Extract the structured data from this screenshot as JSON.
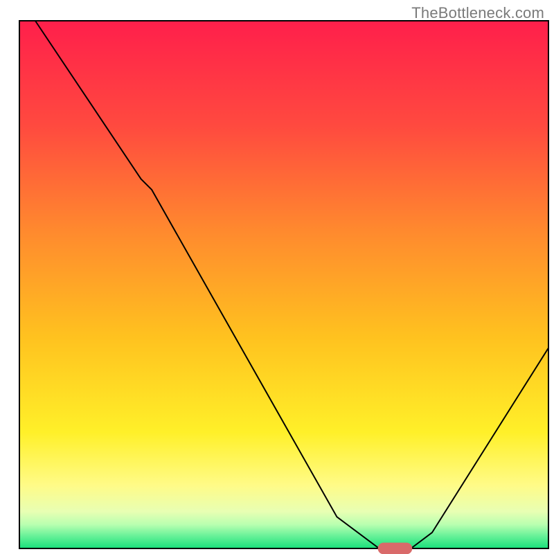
{
  "watermark": "TheBottleneck.com",
  "chart_data": {
    "type": "line",
    "title": "",
    "xlabel": "",
    "ylabel": "",
    "xlim": [
      0,
      100
    ],
    "ylim": [
      0,
      100
    ],
    "grid": false,
    "legend": false,
    "background": {
      "type": "vertical-gradient",
      "stops": [
        {
          "pos": 0.0,
          "color": "#ff1f4b"
        },
        {
          "pos": 0.2,
          "color": "#ff4a3f"
        },
        {
          "pos": 0.4,
          "color": "#ff8a2e"
        },
        {
          "pos": 0.6,
          "color": "#ffc21f"
        },
        {
          "pos": 0.78,
          "color": "#fff029"
        },
        {
          "pos": 0.88,
          "color": "#fffb87"
        },
        {
          "pos": 0.93,
          "color": "#e8ffb3"
        },
        {
          "pos": 0.955,
          "color": "#b8ffb0"
        },
        {
          "pos": 0.975,
          "color": "#6cf29a"
        },
        {
          "pos": 1.0,
          "color": "#18e07a"
        }
      ]
    },
    "curve": {
      "color": "#000000",
      "width": 2,
      "x": [
        3,
        15,
        23,
        25,
        60,
        68,
        74,
        78,
        100
      ],
      "y": [
        100,
        82,
        70,
        68,
        6,
        0,
        0,
        3,
        38
      ]
    },
    "marker": {
      "shape": "capsule",
      "x_center": 71,
      "y_center": 0,
      "width_pct": 6.5,
      "height_pct": 2.2,
      "color": "#d96a6a"
    }
  }
}
